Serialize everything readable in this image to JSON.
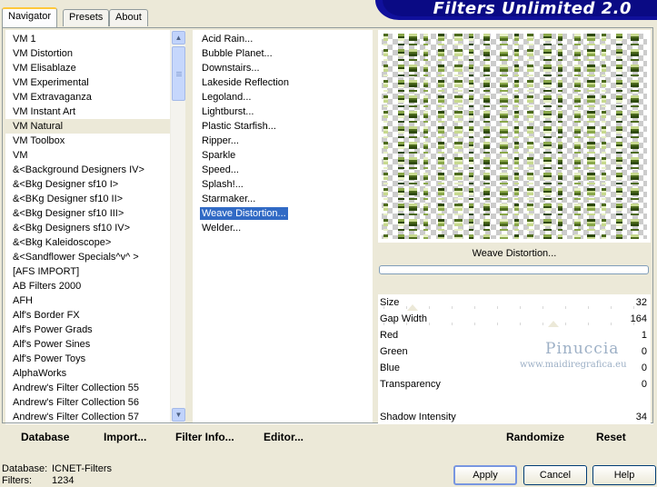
{
  "tabs": [
    {
      "label": "Navigator",
      "active": true
    },
    {
      "label": "Presets",
      "active": false
    },
    {
      "label": "About",
      "active": false
    }
  ],
  "banner": {
    "title": "Filters Unlimited 2.0"
  },
  "categories": {
    "selected": "VM Natural",
    "items": [
      "VM 1",
      "VM Distortion",
      "VM Elisablaze",
      "VM Experimental",
      "VM Extravaganza",
      "VM Instant Art",
      "VM Natural",
      "VM Toolbox",
      "VM",
      "&<Background Designers IV>",
      "&<Bkg Designer sf10 I>",
      "&<BKg Designer sf10 II>",
      "&<Bkg Designer sf10 III>",
      "&<Bkg Designers sf10 IV>",
      "&<Bkg Kaleidoscope>",
      "&<Sandflower Specials^v^ >",
      "[AFS IMPORT]",
      "AB Filters 2000",
      "AFH",
      "Alf's Border FX",
      "Alf's Power Grads",
      "Alf's Power Sines",
      "Alf's Power Toys",
      "AlphaWorks",
      "Andrew's Filter Collection 55",
      "Andrew's Filter Collection 56",
      "Andrew's Filter Collection 57"
    ],
    "scrollbar": {
      "up_icon": "chevron-up-icon",
      "down_icon": "chevron-down-icon"
    }
  },
  "filters": {
    "selected": "Weave Distortion...",
    "items": [
      "Acid Rain...",
      "Bubble Planet...",
      "Downstairs...",
      "Lakeside Reflection",
      "Legoland...",
      "Lightburst...",
      "Plastic Starfish...",
      "Ripper...",
      "Sparkle",
      "Speed...",
      "Splash!...",
      "Starmaker...",
      "Weave Distortion...",
      "Welder..."
    ]
  },
  "preview": {
    "filter_name": "Weave Distortion...",
    "stripe_colors": [
      "#4d6b1e",
      "#8aa84a",
      "#c7d98e",
      "#e6efc4",
      "#2f4a0f"
    ]
  },
  "progress": {
    "percent": 0
  },
  "params": [
    {
      "label": "Size",
      "value": "32",
      "slider_fraction": 0.125
    },
    {
      "label": "Gap Width",
      "value": "164",
      "slider_fraction": 0.643
    },
    {
      "label": "Red",
      "value": "1",
      "slider_fraction": null
    },
    {
      "label": "Green",
      "value": "0",
      "slider_fraction": null
    },
    {
      "label": "Blue",
      "value": "0",
      "slider_fraction": null
    },
    {
      "label": "Transparency",
      "value": "0",
      "slider_fraction": null
    },
    {
      "label": "",
      "value": "",
      "slider_fraction": null
    },
    {
      "label": "Shadow Intensity",
      "value": "34",
      "slider_fraction": null
    }
  ],
  "watermark": {
    "title": "Pinuccia",
    "url": "www.maidiregrafica.eu"
  },
  "toolbar": {
    "database": "Database",
    "import": "Import...",
    "filter_info": "Filter Info...",
    "editor": "Editor...",
    "randomize": "Randomize",
    "reset": "Reset"
  },
  "status": {
    "database_label": "Database:",
    "database_value": "ICNET-Filters",
    "filters_label": "Filters:",
    "filters_value": "1234"
  },
  "buttons": {
    "apply": "Apply",
    "cancel": "Cancel",
    "help": "Help"
  }
}
